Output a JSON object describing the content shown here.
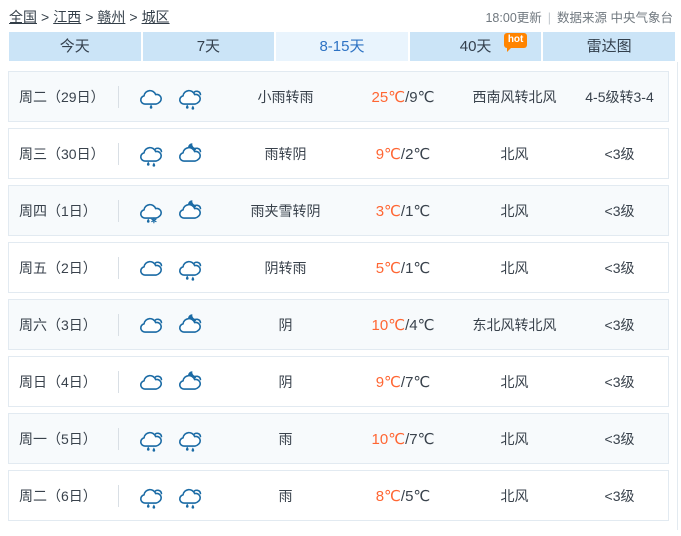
{
  "breadcrumb": {
    "separator": ">",
    "items": [
      "全国",
      "江西",
      "赣州",
      "城区"
    ]
  },
  "meta": {
    "updated": "18:00更新",
    "divider": "|",
    "source": "数据来源 中央气象台"
  },
  "tabs": [
    {
      "label": "今天"
    },
    {
      "label": "7天"
    },
    {
      "label": "8-15天"
    },
    {
      "label": "40天",
      "badge": "hot"
    },
    {
      "label": "雷达图"
    }
  ],
  "colors": {
    "tab_bg": "#cbe4f7",
    "tab_alt_bg": "#e9f4fd",
    "tab_alt_text": "#2e73c4",
    "badge_bg": "#ff8400",
    "temp_high": "#ff6633",
    "icon_stroke": "#1b6ba5",
    "row_border": "#e2eaf1",
    "row_tint": "#f7fafc"
  },
  "rows": [
    {
      "day": "周二（29日）",
      "icons": [
        "cloud-rain-light",
        "cloud-rain"
      ],
      "weather": "小雨转雨",
      "temp_high": "25℃",
      "temp_low": "/9℃",
      "wind": "西南风转北风",
      "level": "4-5级转3-4"
    },
    {
      "day": "周三（30日）",
      "icons": [
        "cloud-rain",
        "cloud-moon"
      ],
      "weather": "雨转阴",
      "temp_high": "9℃",
      "temp_low": "/2℃",
      "wind": "北风",
      "level": "<3级"
    },
    {
      "day": "周四（1日）",
      "icons": [
        "cloud-sleet",
        "cloud-moon"
      ],
      "weather": "雨夹雪转阴",
      "temp_high": "3℃",
      "temp_low": "/1℃",
      "wind": "北风",
      "level": "<3级"
    },
    {
      "day": "周五（2日）",
      "icons": [
        "cloud",
        "cloud-rain"
      ],
      "weather": "阴转雨",
      "temp_high": "5℃",
      "temp_low": "/1℃",
      "wind": "北风",
      "level": "<3级"
    },
    {
      "day": "周六（3日）",
      "icons": [
        "cloud",
        "cloud-moon"
      ],
      "weather": "阴",
      "temp_high": "10℃",
      "temp_low": "/4℃",
      "wind": "东北风转北风",
      "level": "<3级"
    },
    {
      "day": "周日（4日）",
      "icons": [
        "cloud",
        "cloud-moon"
      ],
      "weather": "阴",
      "temp_high": "9℃",
      "temp_low": "/7℃",
      "wind": "北风",
      "level": "<3级"
    },
    {
      "day": "周一（5日）",
      "icons": [
        "cloud-rain",
        "cloud-rain"
      ],
      "weather": "雨",
      "temp_high": "10℃",
      "temp_low": "/7℃",
      "wind": "北风",
      "level": "<3级"
    },
    {
      "day": "周二（6日）",
      "icons": [
        "cloud-rain",
        "cloud-rain"
      ],
      "weather": "雨",
      "temp_high": "8℃",
      "temp_low": "/5℃",
      "wind": "北风",
      "level": "<3级"
    }
  ]
}
